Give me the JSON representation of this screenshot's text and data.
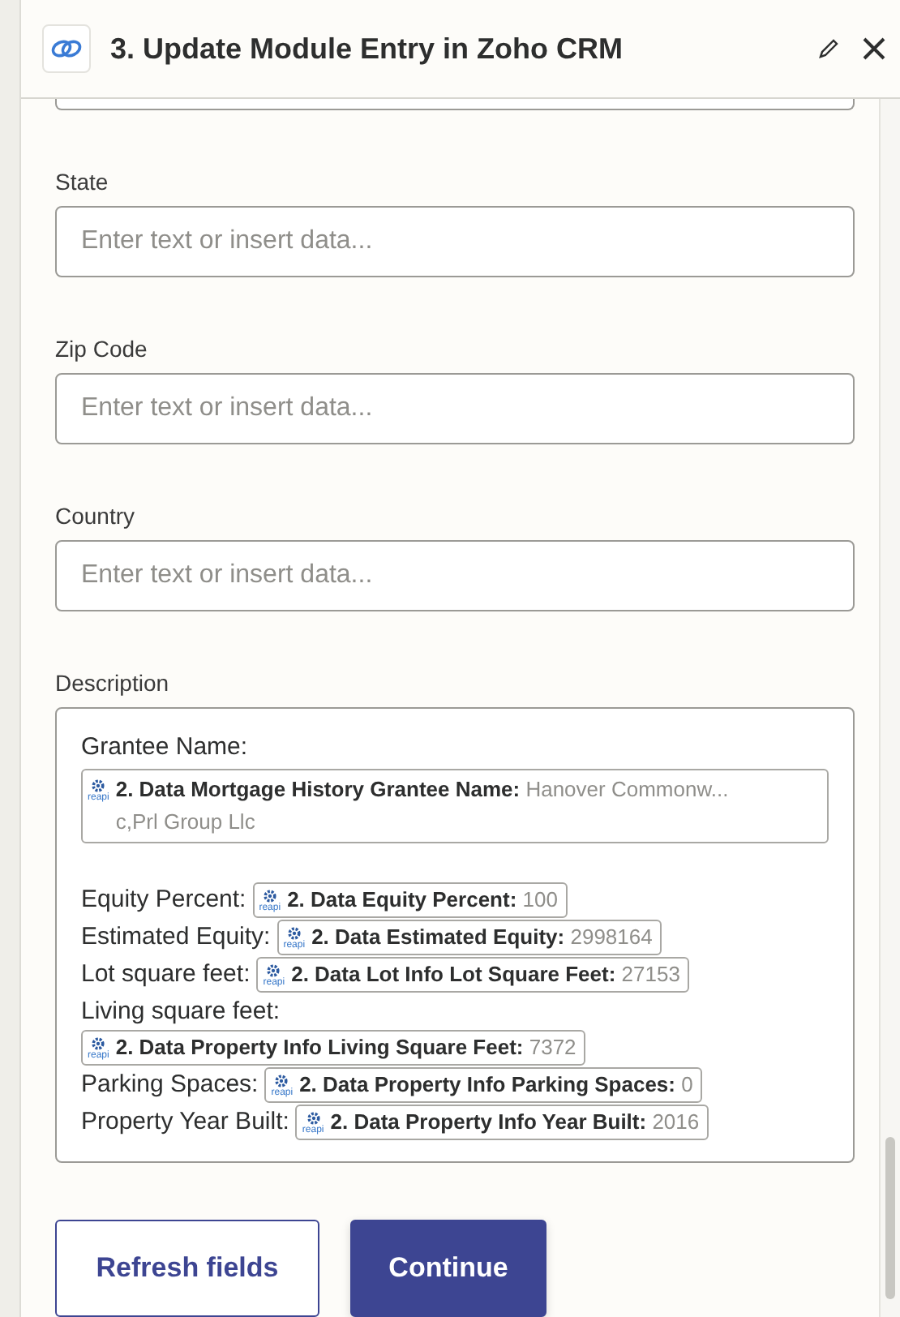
{
  "header": {
    "title": "3. Update Module Entry in Zoho CRM"
  },
  "fields": [
    {
      "label": "State",
      "placeholder": "Enter text or insert data..."
    },
    {
      "label": "Zip Code",
      "placeholder": "Enter text or insert data..."
    },
    {
      "label": "Country",
      "placeholder": "Enter text or insert data..."
    }
  ],
  "description": {
    "label": "Description",
    "lines": [
      {
        "kind": "wide",
        "label": "Grantee Name:",
        "token": {
          "icon_label": "reapi",
          "name": "2. Data Mortgage History Grantee Name:",
          "value_lines": [
            "Hanover Commonw...",
            "c,Prl Group Llc"
          ]
        }
      },
      {
        "kind": "inline",
        "label": "Equity Percent:",
        "token": {
          "icon_label": "reapi",
          "name": "2. Data Equity Percent:",
          "value_lines": [
            "100"
          ]
        }
      },
      {
        "kind": "inline",
        "label": "Estimated Equity:",
        "token": {
          "icon_label": "reapi",
          "name": "2. Data Estimated Equity:",
          "value_lines": [
            "2998164"
          ]
        }
      },
      {
        "kind": "inline",
        "label": "Lot square feet:",
        "token": {
          "icon_label": "reapi",
          "name": "2. Data Lot Info Lot Square Feet:",
          "value_lines": [
            "27153"
          ]
        }
      },
      {
        "kind": "below",
        "label": "Living square feet:",
        "token": {
          "icon_label": "reapi",
          "name": "2. Data Property Info Living Square Feet:",
          "value_lines": [
            "7372"
          ]
        }
      },
      {
        "kind": "inline",
        "label": "Parking Spaces:",
        "token": {
          "icon_label": "reapi",
          "name": "2. Data Property Info Parking Spaces:",
          "value_lines": [
            "0"
          ]
        }
      },
      {
        "kind": "inline",
        "label": "Property Year Built:",
        "token": {
          "icon_label": "reapi",
          "name": "2. Data Property Info Year Built:",
          "value_lines": [
            "2016"
          ]
        }
      }
    ]
  },
  "buttons": [
    {
      "kind": "secondary",
      "label": "Refresh fields"
    },
    {
      "kind": "primary",
      "label": "Continue"
    }
  ]
}
